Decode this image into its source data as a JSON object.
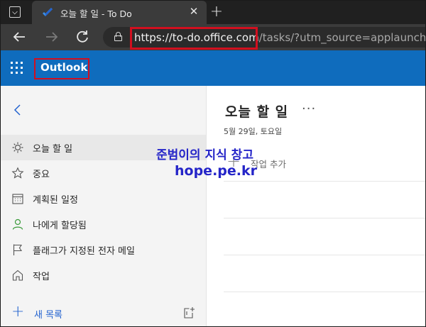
{
  "browser": {
    "tab": {
      "title": "오늘 할 일 - To Do"
    },
    "new_tab_symbol": "+",
    "close_symbol": "✕",
    "address": {
      "host": "https://to-do.office.com",
      "path": "/tasks/?utm_source=applauncher"
    },
    "colors": {
      "highlight_box": "#d10f1f"
    }
  },
  "appbar": {
    "name": "Outlook",
    "color": "#0f6cbd"
  },
  "sidebar": {
    "items": [
      {
        "label": "오늘 할 일",
        "icon": "sun-icon",
        "selected": true
      },
      {
        "label": "중요",
        "icon": "star-icon",
        "selected": false
      },
      {
        "label": "계획된 일정",
        "icon": "calendar-icon",
        "selected": false
      },
      {
        "label": "나에게 할당됨",
        "icon": "person-icon",
        "selected": false
      },
      {
        "label": "플래그가 지정된 전자 메일",
        "icon": "flag-icon",
        "selected": false
      },
      {
        "label": "작업",
        "icon": "home-icon",
        "selected": false
      }
    ],
    "new_list_label": "새 목록"
  },
  "main": {
    "title": "오늘 할 일",
    "more": "···",
    "date": "5월 29일, 토요일",
    "add_task_label": "작업 추가"
  },
  "watermark": {
    "line1": "준범이의 지식 창고",
    "line2": "hope.pe.kr"
  }
}
